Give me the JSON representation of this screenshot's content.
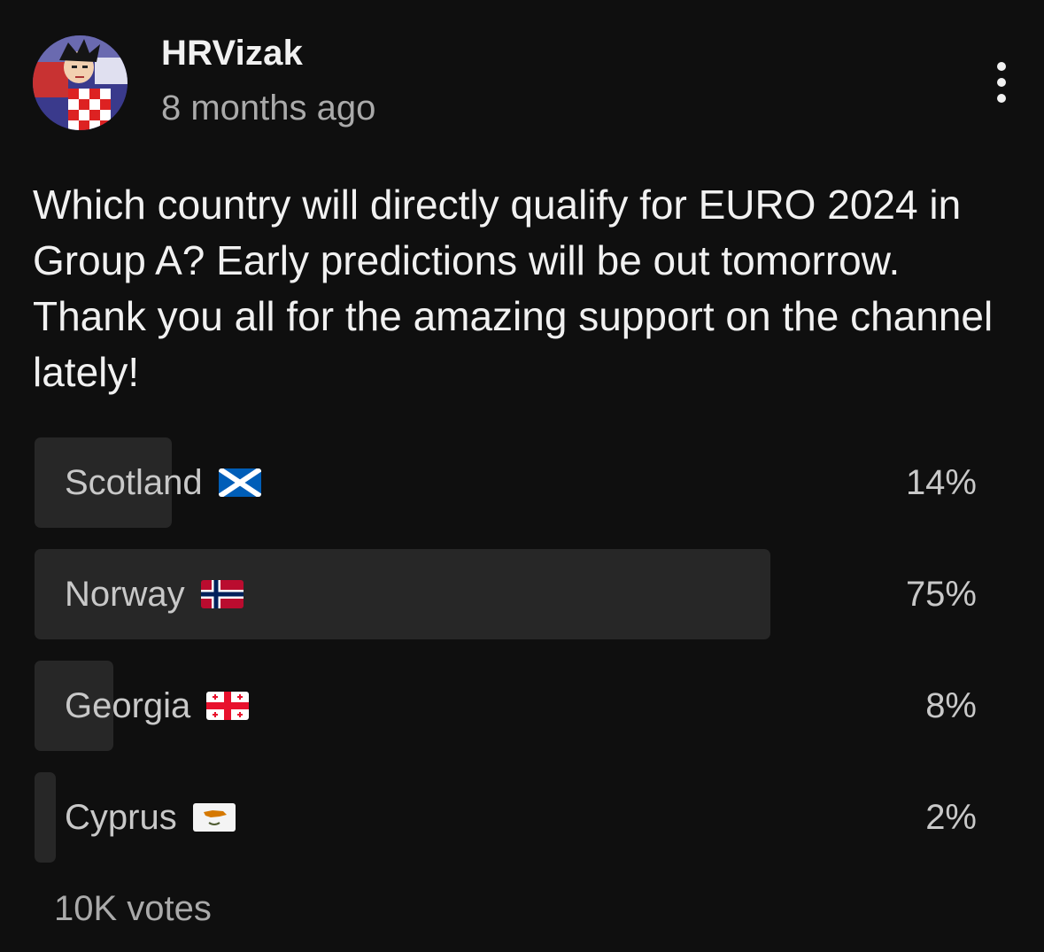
{
  "post": {
    "author": "HRVizak",
    "timestamp": "8 months ago",
    "text": "Which country will directly qualify for EURO 2024 in Group A? Early predictions will be out tomorrow. Thank you all for the amazing support on the channel lately!",
    "menu_icon": "more-vert-icon"
  },
  "poll": {
    "options": [
      {
        "label": "Scotland",
        "flag_icon": "scotland-flag-icon",
        "percent_label": "14%",
        "percent": 14
      },
      {
        "label": "Norway",
        "flag_icon": "norway-flag-icon",
        "percent_label": "75%",
        "percent": 75
      },
      {
        "label": "Georgia",
        "flag_icon": "georgia-flag-icon",
        "percent_label": "8%",
        "percent": 8
      },
      {
        "label": "Cyprus",
        "flag_icon": "cyprus-flag-icon",
        "percent_label": "2%",
        "percent": 2
      }
    ],
    "votes_label": "10K votes"
  },
  "colors": {
    "background": "#0f0f0f",
    "bar_fill": "#272727",
    "text_primary": "#f1f1f1",
    "text_secondary": "#aaaaaa"
  }
}
